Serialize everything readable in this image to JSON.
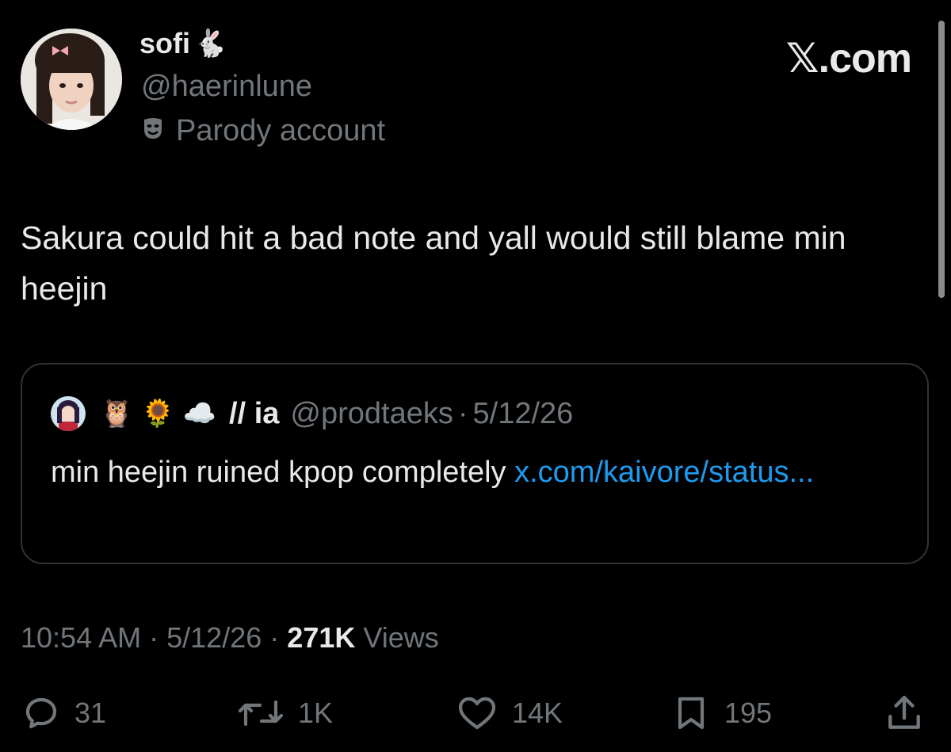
{
  "author": {
    "display_name": "sofi",
    "name_emoji": "🐇",
    "handle": "@haerinlune",
    "label_icon": "parody-mask-icon",
    "label": "Parody account"
  },
  "brand": {
    "text": "𝕏.com"
  },
  "tweet": {
    "text": "Sakura could hit a bad note and yall would still blame min heejin"
  },
  "quote": {
    "emojis": [
      "🦉",
      "🌻",
      "☁️"
    ],
    "name": "// ia",
    "handle": "@prodtaeks",
    "separator": "·",
    "date": "5/12/26",
    "text": "min heejin ruined kpop completely ",
    "link": "x.com/kaivore/status..."
  },
  "meta": {
    "time": "10:54 AM",
    "separator": "·",
    "date": "5/12/26",
    "views_count": "271K",
    "views_label": "Views"
  },
  "actions": {
    "replies": "31",
    "reposts": "1K",
    "likes": "14K",
    "bookmarks": "195"
  },
  "colors": {
    "background": "#000000",
    "text": "#e7e9ea",
    "muted": "#71767b",
    "link": "#1d9bf0",
    "border": "#2f3336"
  }
}
